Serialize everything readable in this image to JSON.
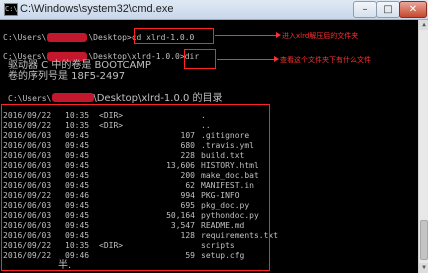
{
  "window": {
    "title": "C:\\Windows\\system32\\cmd.exe",
    "icon_label": "C:\\",
    "minimize_glyph": "–",
    "maximize_glyph": "□",
    "close_glyph": "✕"
  },
  "console": {
    "cmd_cd_prefix": "C:\\Users\\",
    "cmd_cd_middle": "\\Desktop>",
    "cmd_cd_command": "cd xlrd-1.0.0",
    "cmd_dir_prompt": "C:\\Users\\",
    "cmd_dir_middle": "\\Desktop\\xlrd-1.0.0>",
    "cmd_dir_command": "dir",
    "volume_label_line": "驱动器 C 中的卷是 BOOTCAMP",
    "volume_serial_line": "卷的序列号是 18F5-2497",
    "dir_of_prefix": "C:\\Users\\",
    "dir_of_suffix": "\\Desktop\\xlrd-1.0.0 的目录",
    "trailing_text": "半.",
    "listing": [
      {
        "date": "2016/09/22",
        "time": "10:35",
        "dir": "<DIR>",
        "size": "",
        "name": "."
      },
      {
        "date": "2016/09/22",
        "time": "10:35",
        "dir": "<DIR>",
        "size": "",
        "name": ".."
      },
      {
        "date": "2016/06/03",
        "time": "09:45",
        "dir": "",
        "size": "107",
        "name": ".gitignore"
      },
      {
        "date": "2016/06/03",
        "time": "09:45",
        "dir": "",
        "size": "680",
        "name": ".travis.yml"
      },
      {
        "date": "2016/06/03",
        "time": "09:45",
        "dir": "",
        "size": "228",
        "name": "build.txt"
      },
      {
        "date": "2016/06/03",
        "time": "09:45",
        "dir": "",
        "size": "13,606",
        "name": "HISTORY.html"
      },
      {
        "date": "2016/06/03",
        "time": "09:45",
        "dir": "",
        "size": "200",
        "name": "make_doc.bat"
      },
      {
        "date": "2016/06/03",
        "time": "09:45",
        "dir": "",
        "size": "62",
        "name": "MANIFEST.in"
      },
      {
        "date": "2016/09/22",
        "time": "09:46",
        "dir": "",
        "size": "994",
        "name": "PKG-INFO"
      },
      {
        "date": "2016/06/03",
        "time": "09:45",
        "dir": "",
        "size": "695",
        "name": "pkg_doc.py"
      },
      {
        "date": "2016/06/03",
        "time": "09:45",
        "dir": "",
        "size": "50,164",
        "name": "pythondoc.py"
      },
      {
        "date": "2016/06/03",
        "time": "09:45",
        "dir": "",
        "size": "3,547",
        "name": "README.md"
      },
      {
        "date": "2016/06/03",
        "time": "09:45",
        "dir": "",
        "size": "128",
        "name": "requirements.txt"
      },
      {
        "date": "2016/09/22",
        "time": "10:35",
        "dir": "<DIR>",
        "size": "",
        "name": "scripts"
      },
      {
        "date": "2016/09/22",
        "time": "09:46",
        "dir": "",
        "size": "59",
        "name": "setup.cfg"
      }
    ]
  },
  "annotations": {
    "cd_note": "进入xlrd解压后的文件夹",
    "dir_note": "查看这个文件夹下有什么文件"
  },
  "colors": {
    "console_bg": "#000000",
    "console_text": "#c0c0c0",
    "annotation": "#ff2222",
    "redaction": "#c2172c"
  },
  "scrollbar": {
    "up_glyph": "▲",
    "down_glyph": "▼"
  }
}
